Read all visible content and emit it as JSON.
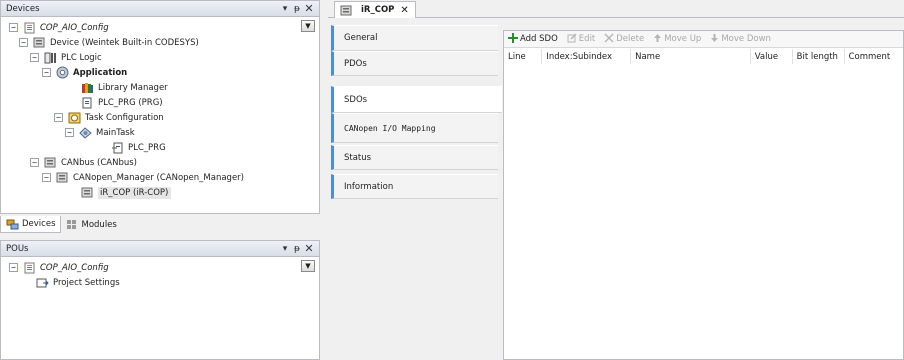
{
  "devices_panel": {
    "title": "Devices",
    "tree": [
      {
        "label": "COP_AIO_Config",
        "icon": "config-icon",
        "italic": true,
        "expander": "minus"
      },
      {
        "label": "Device (Weintek Built-in CODESYS)",
        "icon": "device-icon",
        "expander": "minus"
      },
      {
        "label": "PLC Logic",
        "icon": "plc-logic-icon",
        "expander": "minus"
      },
      {
        "label": "Application",
        "icon": "application-gear-icon",
        "bold": true,
        "expander": "minus"
      },
      {
        "label": "Library Manager",
        "icon": "library-books-icon"
      },
      {
        "label": "PLC_PRG (PRG)",
        "icon": "program-file-icon"
      },
      {
        "label": "Task Configuration",
        "icon": "task-config-icon",
        "expander": "minus"
      },
      {
        "label": "MainTask",
        "icon": "task-icon",
        "expander": "minus"
      },
      {
        "label": "PLC_PRG",
        "icon": "program-call-icon"
      },
      {
        "label": "CANbus (CANbus)",
        "icon": "device-icon",
        "expander": "minus"
      },
      {
        "label": "CANopen_Manager (CANopen_Manager)",
        "icon": "device-icon",
        "expander": "minus"
      },
      {
        "label": "iR_COP (iR-COP)",
        "icon": "device-icon",
        "selected": true
      }
    ]
  },
  "panel_tabs": [
    {
      "label": "Devices",
      "icon": "devices-tab-icon",
      "active": true
    },
    {
      "label": "Modules",
      "icon": "modules-tab-icon",
      "active": false
    }
  ],
  "pous_panel": {
    "title": "POUs",
    "tree": [
      {
        "label": "COP_AIO_Config",
        "icon": "config-icon",
        "italic": true,
        "expander": "minus"
      },
      {
        "label": "Project Settings",
        "icon": "project-settings-icon"
      }
    ]
  },
  "header_buttons": {
    "dropdown": "▾",
    "pin": "ᵽ",
    "close": "✕"
  },
  "document_tab": {
    "label": "iR_COP",
    "close": "✕",
    "icon": "device-icon"
  },
  "side_tabs": [
    {
      "label": "General",
      "active": false
    },
    {
      "label": "PDOs",
      "active": false
    },
    {
      "label": "SDOs",
      "active": true
    },
    {
      "label": "CANopen I/O Mapping",
      "active": false,
      "mono": true
    },
    {
      "label": "Status",
      "active": false
    },
    {
      "label": "Information",
      "active": false
    }
  ],
  "toolbar": {
    "add_sdo": "Add SDO",
    "edit": "Edit",
    "delete": "Delete",
    "move_up": "Move Up",
    "move_down": "Move Down"
  },
  "sdo_table": {
    "columns": [
      "Line",
      "Index:Subindex",
      "Name",
      "Value",
      "Bit length",
      "Comment"
    ]
  },
  "colors": {
    "accent_tab_border": "#4a90d9",
    "selection_bg": "#e6e6e6",
    "panel_border": "#b9bcc2"
  }
}
